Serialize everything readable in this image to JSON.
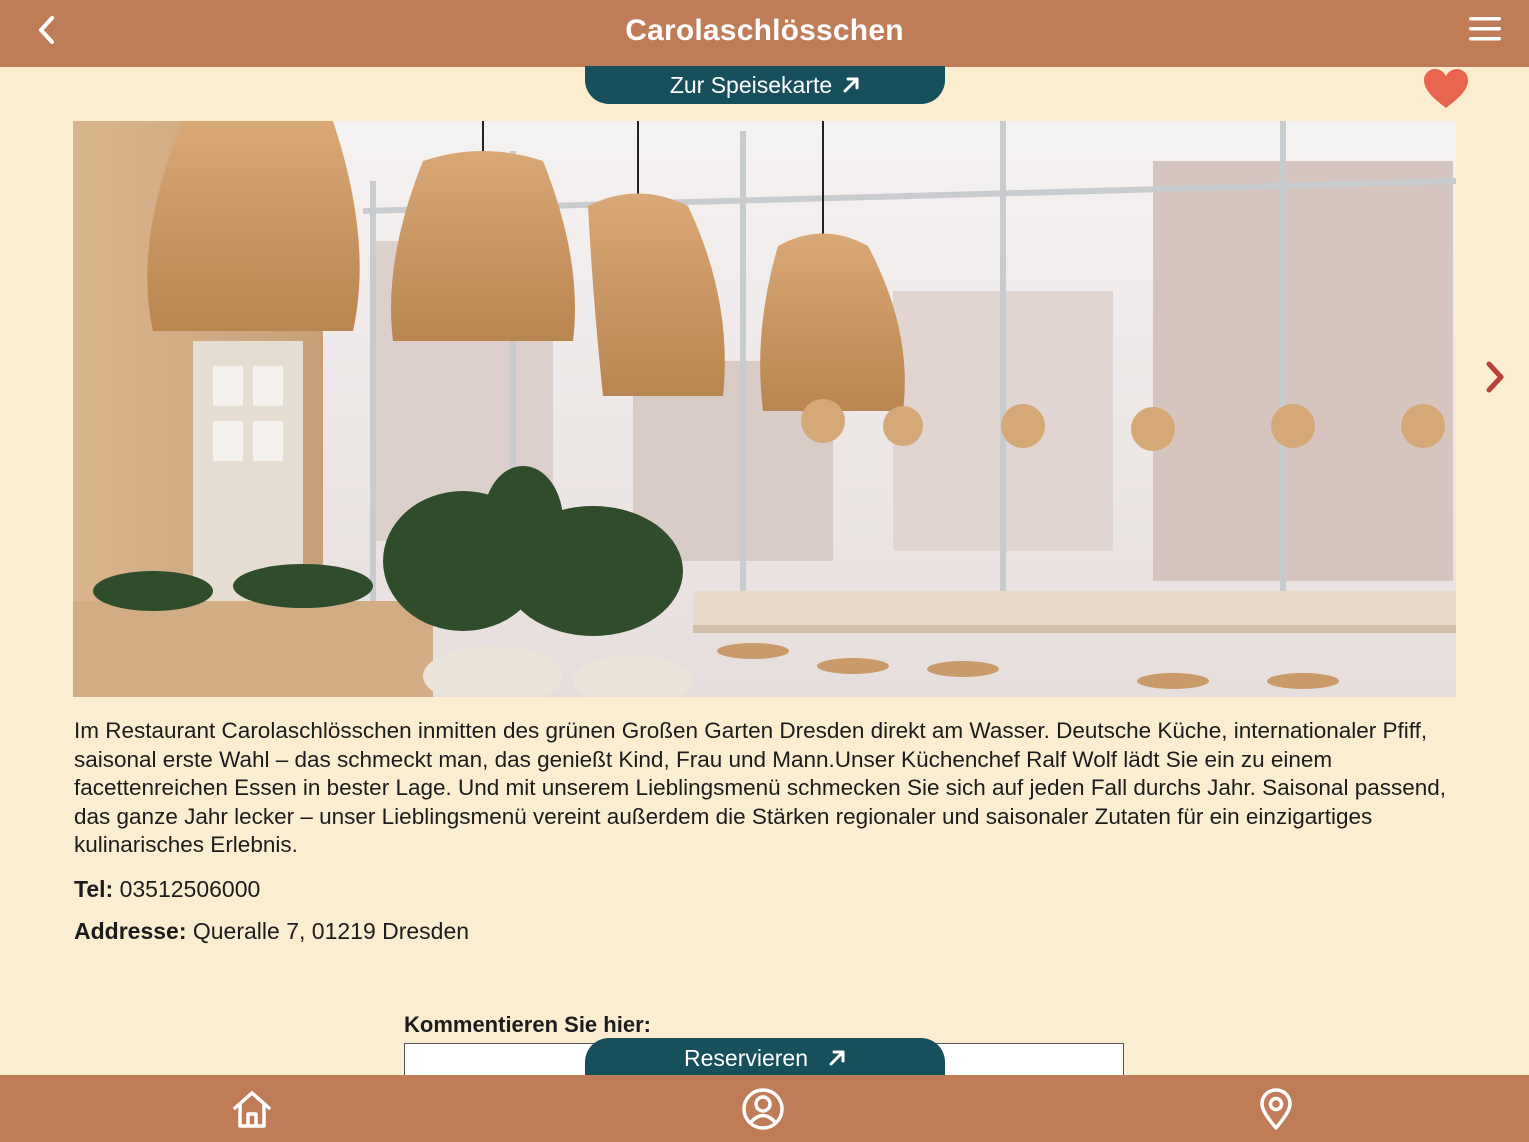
{
  "header": {
    "title": "Carolaschlösschen",
    "menu_button_label": "Zur Speisekarte"
  },
  "hero": {
    "alt": ""
  },
  "details": {
    "description": "Im Restaurant Carolaschlösschen inmitten des grünen Großen Garten Dresden direkt am Wasser. Deutsche Küche, internationaler Pfiff, saisonal erste Wahl – das schmeckt man, das genießt Kind, Frau und Mann.Unser Küchenchef Ralf Wolf lädt Sie ein zu einem facettenreichen Essen in bester Lage. Und mit unserem Lieblingsmenü schmecken Sie sich auf jeden Fall durchs Jahr. Saisonal passend, das ganze Jahr lecker – unser Lieblingsmenü vereint außerdem die Stärken regionaler und saisonaler Zutaten für ein einzigartiges kulinarisches Erlebnis.",
    "tel_label": "Tel:",
    "tel_value": "03512506000",
    "address_label": "Addresse:",
    "address_value": "Queralle 7, 01219 Dresden"
  },
  "comment": {
    "label": "Kommentieren Sie hier:",
    "value": ""
  },
  "reserve_button_label": "Reservieren",
  "colors": {
    "bar": "#BF7C57",
    "background": "#FBEDD0",
    "button": "#174F5D",
    "heart": "#E8654F",
    "chevron": "#B8413A"
  },
  "icons": [
    "back-icon",
    "menu-icon",
    "external-link-icon",
    "heart-icon",
    "chevron-right-icon",
    "home-icon",
    "profile-icon",
    "location-pin-icon"
  ]
}
